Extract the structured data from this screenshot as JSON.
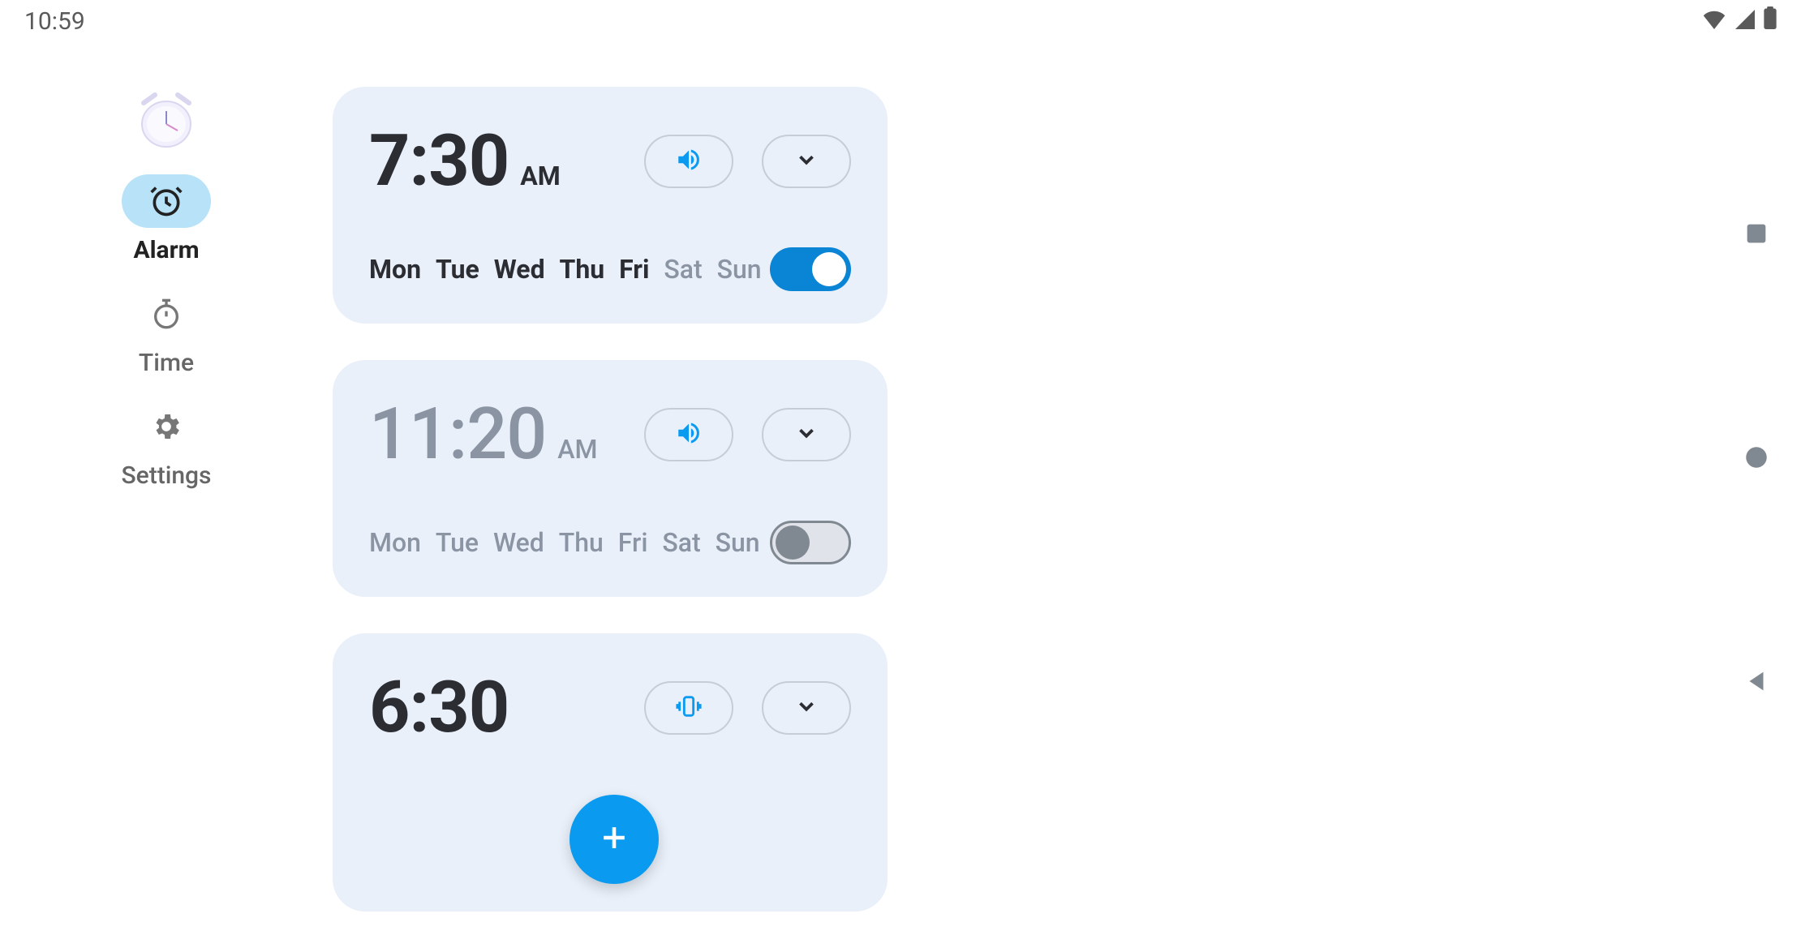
{
  "status": {
    "time": "10:59"
  },
  "sidebar": {
    "items": [
      {
        "label": "Alarm",
        "icon": "alarm-icon",
        "active": true
      },
      {
        "label": "Time",
        "icon": "stopwatch-icon",
        "active": false
      },
      {
        "label": "Settings",
        "icon": "gear-icon",
        "active": false
      }
    ]
  },
  "colors": {
    "accent": "#0a9af0",
    "card": "#e9f0fa"
  },
  "alarms": [
    {
      "time": "7:30",
      "ampm": "AM",
      "enabled": true,
      "sound_icon": "speaker",
      "days": [
        {
          "label": "Mon",
          "on": true
        },
        {
          "label": "Tue",
          "on": true
        },
        {
          "label": "Wed",
          "on": true
        },
        {
          "label": "Thu",
          "on": true
        },
        {
          "label": "Fri",
          "on": true
        },
        {
          "label": "Sat",
          "on": false
        },
        {
          "label": "Sun",
          "on": false
        }
      ]
    },
    {
      "time": "11:20",
      "ampm": "AM",
      "enabled": false,
      "sound_icon": "speaker",
      "days": [
        {
          "label": "Mon",
          "on": false
        },
        {
          "label": "Tue",
          "on": false
        },
        {
          "label": "Wed",
          "on": false
        },
        {
          "label": "Thu",
          "on": false
        },
        {
          "label": "Fri",
          "on": false
        },
        {
          "label": "Sat",
          "on": false
        },
        {
          "label": "Sun",
          "on": false
        }
      ]
    },
    {
      "time": "6:30",
      "ampm": "",
      "enabled": true,
      "sound_icon": "vibrate",
      "days": []
    }
  ]
}
